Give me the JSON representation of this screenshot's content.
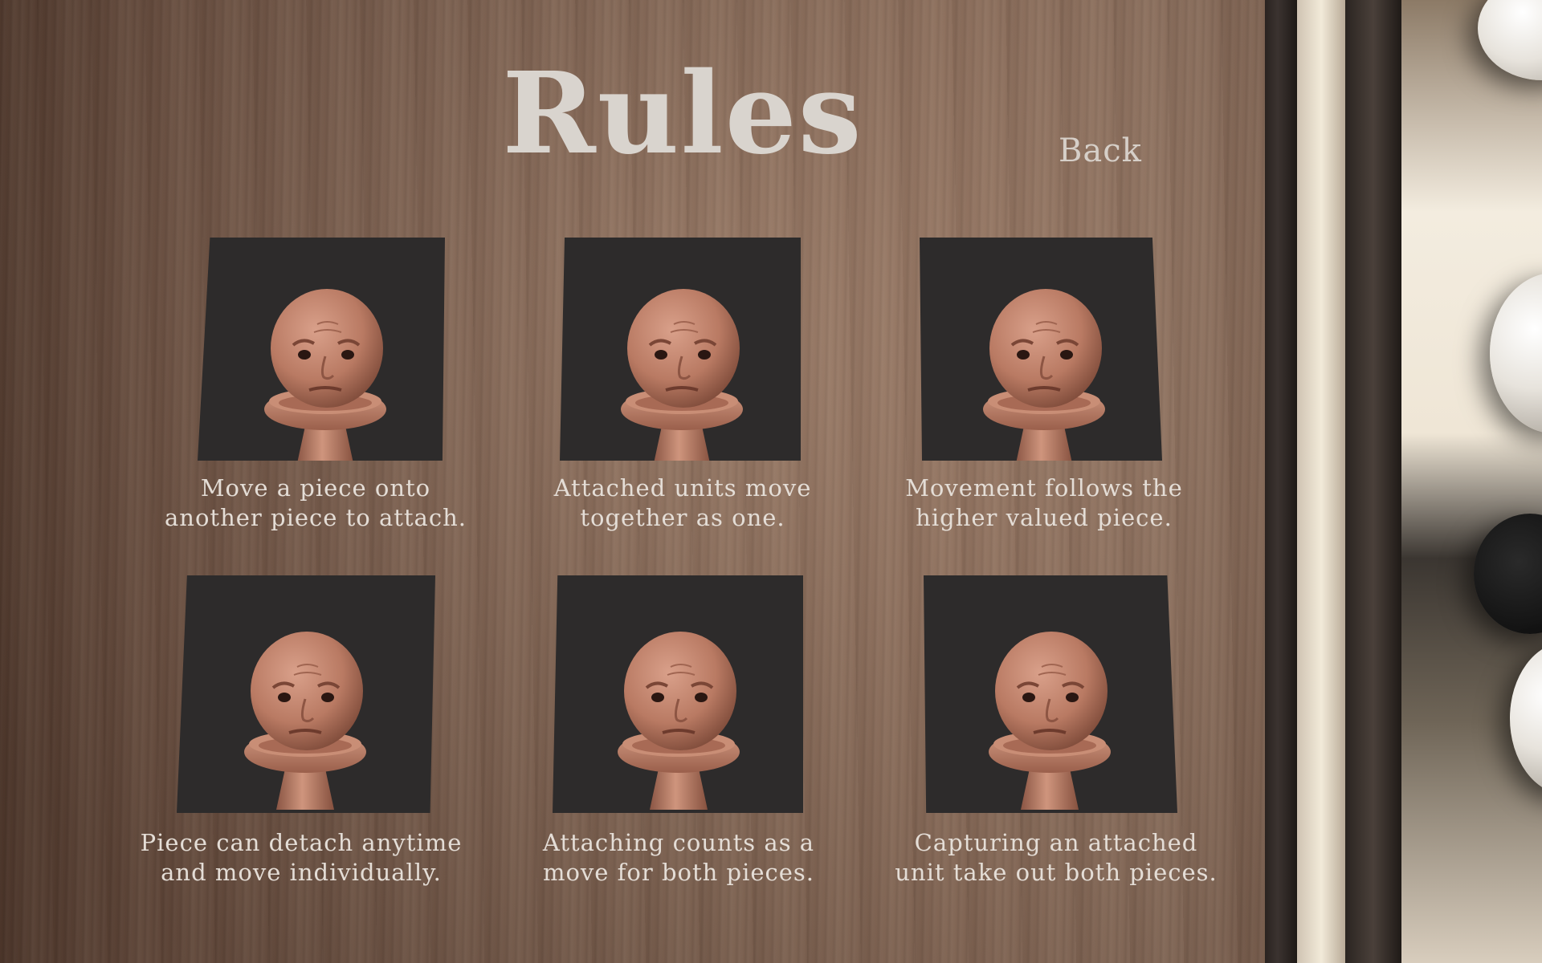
{
  "screen": {
    "title": "Rules",
    "back_label": "Back"
  },
  "rules": [
    {
      "line1": "Move a piece onto",
      "line2": "another piece to attach.",
      "image_icon": "chess-pawn-face-icon"
    },
    {
      "line1": "Attached units move",
      "line2": "together as one.",
      "image_icon": "chess-pawn-face-icon"
    },
    {
      "line1": "Movement follows the",
      "line2": "higher valued piece.",
      "image_icon": "chess-pawn-face-icon"
    },
    {
      "line1": "Piece can detach anytime",
      "line2": "and move individually.",
      "image_icon": "chess-pawn-face-icon"
    },
    {
      "line1": "Attaching counts as a",
      "line2": "move for both pieces.",
      "image_icon": "chess-pawn-face-icon"
    },
    {
      "line1": "Capturing an attached",
      "line2": "unit take out both pieces.",
      "image_icon": "chess-pawn-face-icon"
    }
  ],
  "colors": {
    "text": "#e4ddd6",
    "title": "#d9d4ce",
    "image_bg": "#2d2b2b",
    "piece": "#c08670"
  }
}
